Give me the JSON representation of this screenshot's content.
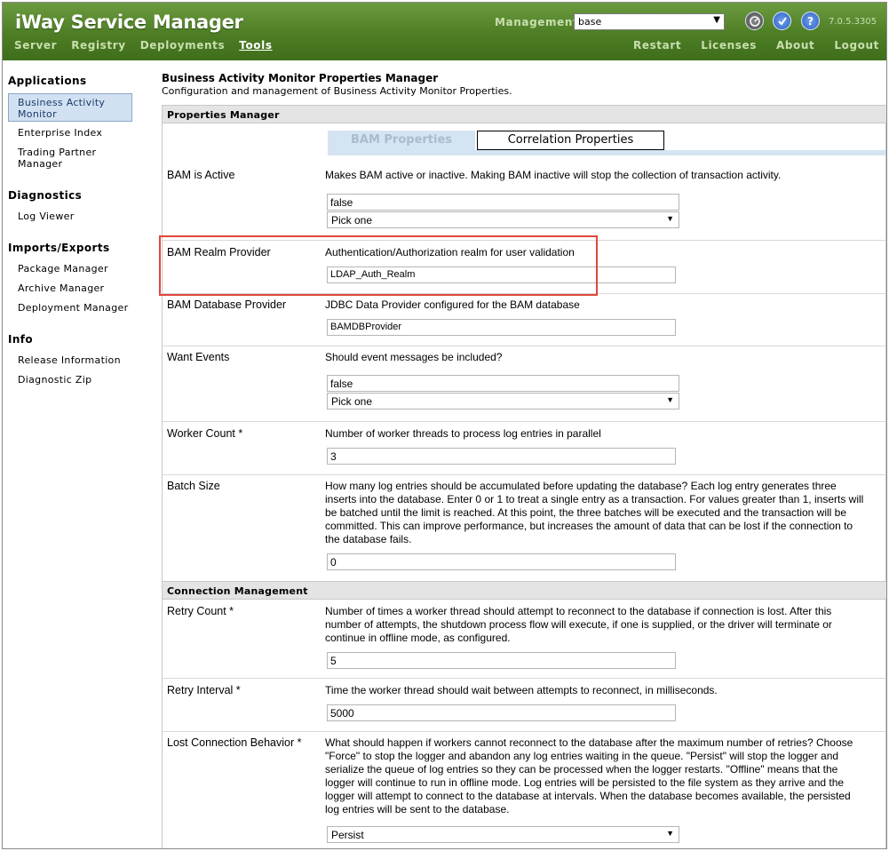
{
  "header": {
    "title": "iWay Service Manager",
    "nav_left": [
      "Server",
      "Registry",
      "Deployments",
      "Tools"
    ],
    "nav_active": "Tools",
    "management_label": "Management",
    "management_value": "base",
    "nav_right": [
      "Restart",
      "Licenses",
      "About",
      "Logout"
    ],
    "version": "7.0.5.3305",
    "icons": [
      "gauge-icon",
      "check-icon",
      "help-icon"
    ],
    "help_glyph": "?"
  },
  "sidebar": {
    "sections": [
      {
        "title": "Applications",
        "items": [
          "Business Activity Monitor",
          "Enterprise Index",
          "Trading Partner Manager"
        ]
      },
      {
        "title": "Diagnostics",
        "items": [
          "Log Viewer"
        ]
      },
      {
        "title": "Imports/Exports",
        "items": [
          "Package Manager",
          "Archive Manager",
          "Deployment Manager"
        ]
      },
      {
        "title": "Info",
        "items": [
          "Release Information",
          "Diagnostic Zip"
        ]
      }
    ],
    "selected": "Business Activity Monitor"
  },
  "main": {
    "title": "Business Activity Monitor Properties Manager",
    "description": "Configuration and management of Business Activity Monitor Properties.",
    "section1": "Properties Manager",
    "tabs": [
      "BAM Properties",
      "Correlation Properties"
    ],
    "active_tab": "BAM Properties",
    "rows": [
      {
        "label": "BAM is Active",
        "desc": "Makes BAM active or inactive. Making BAM inactive will stop the collection of transaction activity.",
        "value": "false",
        "select": "Pick one"
      },
      {
        "label": "BAM Realm Provider",
        "desc": "Authentication/Authorization realm for user validation",
        "value": "LDAP_Auth_Realm"
      },
      {
        "label": "BAM Database Provider",
        "desc": "JDBC Data Provider configured for the BAM database",
        "value": "BAMDBProvider"
      },
      {
        "label": "Want Events",
        "desc": "Should event messages be included?",
        "value": "false",
        "select": "Pick one"
      },
      {
        "label": "Worker Count *",
        "desc": "Number of worker threads to process log entries in parallel",
        "value": "3"
      },
      {
        "label": "Batch Size",
        "desc": "How many log entries should be accumulated before updating the database? Each log entry generates three inserts into the database. Enter 0 or 1 to treat a single entry as a transaction. For values greater than 1, inserts will be batched until the limit is reached. At this point, the three batches will be executed and the transaction will be committed. This can improve performance, but increases the amount of data that can be lost if the connection to the database fails.",
        "value": "0"
      }
    ],
    "section2": "Connection Management",
    "rows2": [
      {
        "label": "Retry Count *",
        "desc": "Number of times a worker thread should attempt to reconnect to the database if connection is lost. After this number of attempts, the shutdown process flow will execute, if one is supplied, or the driver will terminate or continue in offline mode, as configured.",
        "value": "5"
      },
      {
        "label": "Retry Interval *",
        "desc": "Time the worker thread should wait between attempts to reconnect, in milliseconds.",
        "value": "5000"
      },
      {
        "label": "Lost Connection Behavior *",
        "desc": "What should happen if workers cannot reconnect to the database after the maximum number of retries? Choose \"Force\" to stop the logger and abandon any log entries waiting in the queue. \"Persist\" will stop the logger and serialize the queue of log entries so they can be processed when the logger restarts. \"Offline\" means that the logger will continue to run in offline mode. Log entries will be persisted to the file system as they arrive and the logger will attempt to connect to the database at intervals. When the database becomes available, the persisted log entries will be sent to the database.",
        "select": "Persist"
      }
    ]
  }
}
